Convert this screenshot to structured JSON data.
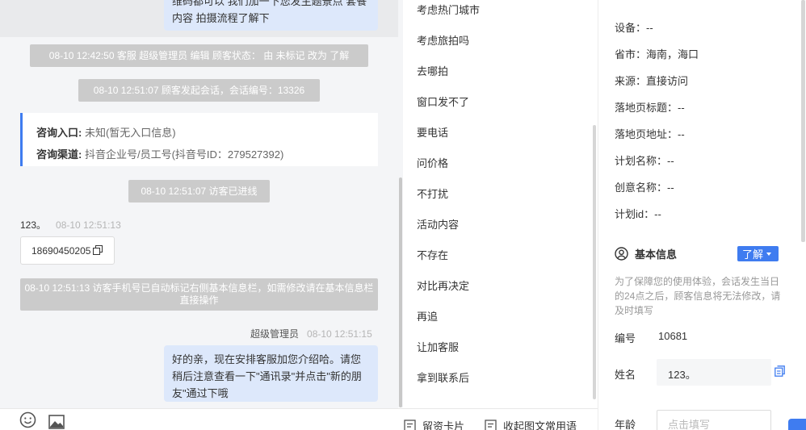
{
  "chat": {
    "top_bubble": "维码都可以 我们加一下您发主题景点 套餐内容 拍摄流程了解下",
    "system_messages": [
      "08-10 12:42:50 客服 超级管理员 编辑 顾客状态： 由 未标记 改为 了解",
      "08-10 12:51:07 顾客发起会话，会话编号：13326",
      "08-10 12:51:07 访客已进线",
      "08-10 12:51:13 访客手机号已自动标记右侧基本信息栏，如需修改请在基本信息栏直接操作"
    ],
    "entry_card": {
      "entry_label": "咨询入口:",
      "entry_value": "未知(暂无入口信息)",
      "channel_label": "咨询渠道:",
      "channel_value": "抖音企业号/员工号(抖音号ID：279527392)"
    },
    "visitor": {
      "name": "123。",
      "time": "08-10 12:51:13",
      "phone": "18690450205"
    },
    "agent": {
      "name": "超级管理员",
      "time": "08-10 12:51:15",
      "message": "好的亲，现在安排客服加您介绍哈。请您稍后注意查看一下\"通讯录\"并点击\"新的朋友\"通过下哦"
    }
  },
  "bottom_bar": {
    "icons": [
      "emoji-icon",
      "image-icon"
    ],
    "leave_card_label": "留资卡片",
    "collapse_label": "收起图文常用语"
  },
  "quick_replies": [
    "考虑热门城市",
    "考虑旅拍吗",
    "去哪拍",
    "窗口发不了",
    "要电话",
    "问价格",
    "不打扰",
    "活动内容",
    "不存在",
    "对比再决定",
    "再追",
    "让加客服",
    "拿到联系后"
  ],
  "info_panel": {
    "rows": [
      {
        "label": "设备：",
        "value": "--"
      },
      {
        "label": "省市：",
        "value": "海南，海口"
      },
      {
        "label": "来源：",
        "value": "直接访问"
      },
      {
        "label": "落地页标题：",
        "value": "--"
      },
      {
        "label": "落地页地址：",
        "value": "--"
      },
      {
        "label": "计划名称：",
        "value": "--"
      },
      {
        "label": "创意名称：",
        "value": "--"
      },
      {
        "label": "计划id：",
        "value": "--"
      }
    ],
    "section_title": "基本信息",
    "status_value": "了解",
    "notice": "为了保障您的使用体验，会话发生当日的24点之后，顾客信息将无法修改，请及时填写",
    "id_label": "编号",
    "id_value": "10681",
    "name_label": "姓名",
    "name_value": "123。",
    "age_label": "年龄",
    "age_placeholder": "点击填写"
  },
  "colors": {
    "accent": "#3f7cf0",
    "bubble": "#dde8fb",
    "system_bg": "#cbcbcb"
  }
}
